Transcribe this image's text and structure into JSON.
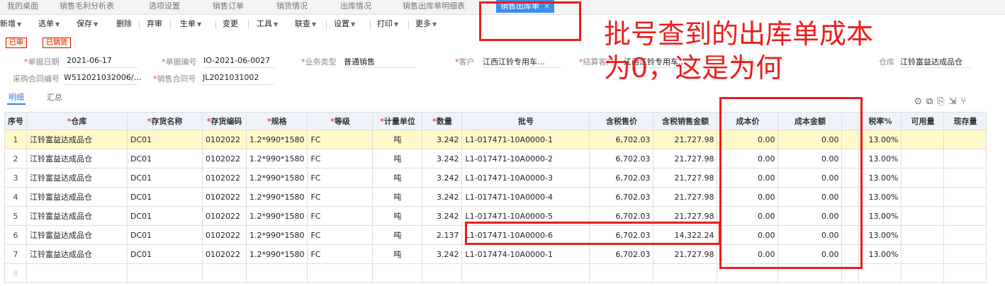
{
  "tabs": [
    "我的桌面",
    "销售毛利分析表",
    "选项设置",
    "销售订单",
    "销货情况",
    "出库情况",
    "销售出库单明细表",
    "销售出库单"
  ],
  "tab_close": "×",
  "toolbar": {
    "items": [
      "新增",
      "选单",
      "保存",
      "删除",
      "弃审",
      "生单",
      "变更",
      "工具",
      "联查",
      "设置",
      "打印",
      "更多"
    ]
  },
  "stamps": [
    "已审",
    "已销货"
  ],
  "form": {
    "date_label": "单据日期",
    "date_value": "2021-06-17",
    "code_label": "单据编号",
    "code_value": "IO-2021-06-0027",
    "biz_label": "业务类型",
    "biz_value": "普通销售",
    "customer_label": "客户",
    "customer_value": "江西江铃专用车…",
    "settle_label": "结算客户",
    "settle_value": "江西江铃专用车…",
    "hidden_label": "销售员",
    "warehouse_label": "仓库",
    "warehouse_value": "江铃富益达成品仓",
    "purchase_label": "采购合同编号",
    "purchase_value": "W512021032006/…",
    "contract_label": "销售合同号",
    "contract_value": "JL2021031002"
  },
  "subtabs": [
    "明细",
    "汇总"
  ],
  "tool_icons": [
    "location-icon",
    "copy-icon",
    "paste-icon",
    "export-icon",
    "split-icon"
  ],
  "columns": [
    "序号",
    "仓库",
    "存货名称",
    "存货编码",
    "规格",
    "等级",
    "计量单位",
    "数量",
    "批号",
    "含税售价",
    "含税销售金额",
    "成本价",
    "成本金额",
    "",
    "税率%",
    "可用量",
    "现存量"
  ],
  "required_cols": [
    1,
    2,
    3,
    4,
    5,
    6,
    7
  ],
  "rows": [
    [
      "1",
      "江铃富益达成品仓",
      "DC01",
      "0102022",
      "1.2*990*1580",
      "FC",
      "吨",
      "3.242",
      "L1-017471-10A0000-1",
      "6,702.03",
      "21,727.98",
      "0.00",
      "0.00",
      "",
      "13.00%",
      "",
      ""
    ],
    [
      "2",
      "江铃富益达成品仓",
      "DC01",
      "0102022",
      "1.2*990*1580",
      "FC",
      "吨",
      "3.242",
      "L1-017471-10A0000-2",
      "6,702.03",
      "21,727.98",
      "0.00",
      "0.00",
      "",
      "13.00%",
      "",
      ""
    ],
    [
      "3",
      "江铃富益达成品仓",
      "DC01",
      "0102022",
      "1.2*990*1580",
      "FC",
      "吨",
      "3.242",
      "L1-017471-10A0000-3",
      "6,702.03",
      "21,727.98",
      "0.00",
      "0.00",
      "",
      "13.00%",
      "",
      ""
    ],
    [
      "4",
      "江铃富益达成品仓",
      "DC01",
      "0102022",
      "1.2*990*1580",
      "FC",
      "吨",
      "3.242",
      "L1-017471-10A0000-4",
      "6,702.03",
      "21,727.98",
      "0.00",
      "0.00",
      "",
      "13.00%",
      "",
      ""
    ],
    [
      "5",
      "江铃富益达成品仓",
      "DC01",
      "0102022",
      "1.2*990*1580",
      "FC",
      "吨",
      "3.242",
      "L1-017471-10A0000-5",
      "6,702.03",
      "21,727.98",
      "0.00",
      "0.00",
      "",
      "13.00%",
      "",
      ""
    ],
    [
      "6",
      "江铃富益达成品仓",
      "DC01",
      "0102022",
      "1.2*990*1580",
      "FC",
      "吨",
      "2.137",
      "L1-017471-10A0000-6",
      "6,702.03",
      "14,322.24",
      "0.00",
      "0.00",
      "",
      "13.00%",
      "",
      ""
    ],
    [
      "7",
      "江铃富益达成品仓",
      "DC01",
      "0102022",
      "1.2*990*1580",
      "FC",
      "吨",
      "3.242",
      "L1-017474-10A0000-1",
      "6,702.03",
      "21,727.98",
      "0.00",
      "0.00",
      "",
      "13.00%",
      "",
      ""
    ]
  ],
  "empty_row_no": "8",
  "annotation": {
    "line1": "批号查到的出库单成本",
    "line2": "为0，这是为何"
  },
  "colors": {
    "accent": "#2f80ed",
    "annotation": "#ee1c1c",
    "selected_row": "#fff9c9"
  }
}
